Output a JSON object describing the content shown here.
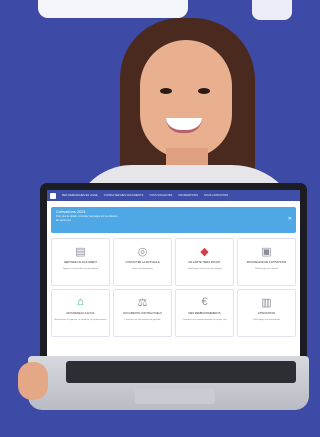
{
  "scene": {
    "background_color": "#3d4aa6",
    "accent_color": "#3f4ea8",
    "banner_color": "#4fa8e6"
  },
  "screen": {
    "nav_items": [
      "MES DEMARCHES EN LIGNE",
      "CONSULTER MES DOCUMENTS",
      "VOUS SOUHAITEZ",
      "INFORMATIONS",
      "NOUS CONTACTER"
    ],
    "banner": {
      "title": "Cotisations 2021",
      "subtitle": "Pour plus de détails, consultez nos pages sur la cotisation.",
      "link": "En savoir plus"
    },
    "tiles": [
      {
        "icon": "document-icon",
        "glyph": "▤",
        "label": "DEPOSER UN DOCUMENT",
        "desc": "Déposer et consulter vos documents",
        "tone": "gray"
      },
      {
        "icon": "target-icon",
        "glyph": "◎",
        "label": "CONTACTER LA MUTUELLE",
        "desc": "Suivre vos demandes",
        "tone": "gray"
      },
      {
        "icon": "card-icon",
        "glyph": "◆",
        "label": "MA CARTE TIERS PAYANT",
        "desc": "Télécharger votre carte tiers payant",
        "tone": "red"
      },
      {
        "icon": "certificate-icon",
        "glyph": "▣",
        "label": "MON RELEVE DE COTISATIONS",
        "desc": "Télécharger vos relevés",
        "tone": "gray"
      },
      {
        "icon": "kalivia-icon",
        "glyph": "⌂",
        "label": "MON RESEAU KALIVIA",
        "desc": "Rechercher un opticien, un dentiste, un professionnel",
        "tone": "teal"
      },
      {
        "icon": "contract-icon",
        "glyph": "⚖",
        "label": "DOCUMENTS CONTRACTUELS",
        "desc": "Consulter vos documents de garantie",
        "tone": "gray"
      },
      {
        "icon": "euro-icon",
        "glyph": "€",
        "label": "MES REMBOURSEMENTS",
        "desc": "Consulter vos remboursements en temps réel",
        "tone": "gray"
      },
      {
        "icon": "file-icon",
        "glyph": "▥",
        "label": "ATTESTATION",
        "desc": "Télécharger vos attestations",
        "tone": "gray"
      }
    ]
  }
}
